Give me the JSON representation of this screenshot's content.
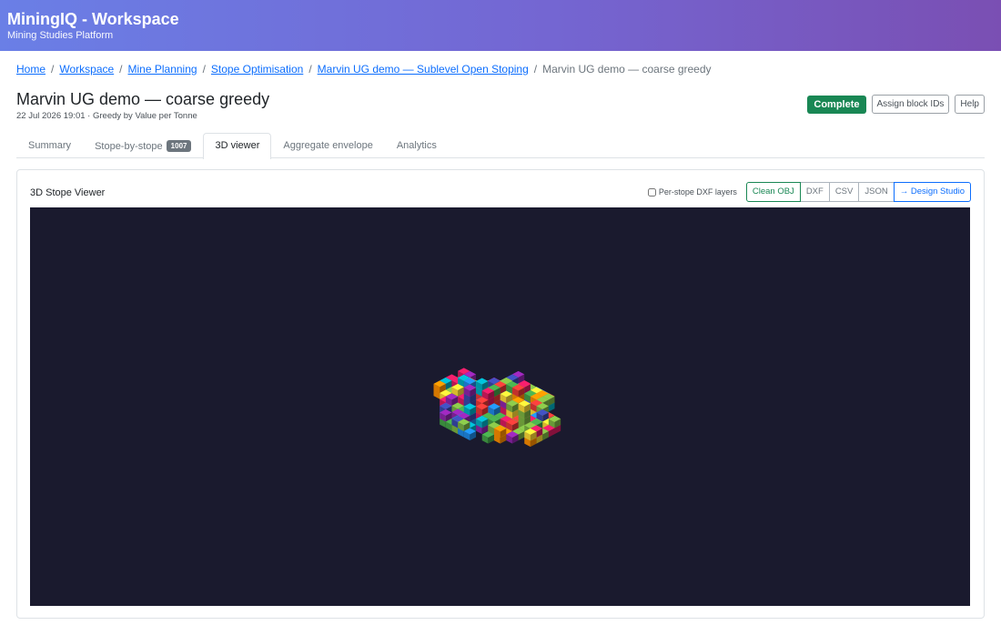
{
  "app": {
    "title": "MiningIQ - Workspace",
    "subtitle": "Mining Studies Platform"
  },
  "breadcrumb": {
    "items": [
      "Home",
      "Workspace",
      "Mine Planning",
      "Stope Optimisation",
      "Marvin UG demo — Sublevel Open Stoping"
    ],
    "current": "Marvin UG demo — coarse greedy",
    "separator": "/"
  },
  "page": {
    "title": "Marvin UG demo — coarse greedy",
    "meta": "22 Jul 2026 19:01 · Greedy by Value per Tonne",
    "status": "Complete",
    "assign_label": "Assign block IDs",
    "help_label": "Help"
  },
  "tabs": [
    {
      "label": "Summary",
      "badge": ""
    },
    {
      "label": "Stope-by-stope",
      "badge": "1007"
    },
    {
      "label": "3D viewer",
      "badge": "",
      "active": true
    },
    {
      "label": "Aggregate envelope",
      "badge": ""
    },
    {
      "label": "Analytics",
      "badge": ""
    }
  ],
  "viewer": {
    "title": "3D Stope Viewer",
    "dxf_layers_label": "Per-stope DXF layers",
    "dxf_layers_checked": false,
    "export_buttons": [
      "Clean OBJ",
      "DXF",
      "CSV",
      "JSON",
      "→ Design Studio"
    ],
    "background": "#1a1a2e",
    "stope_palette": [
      "#e53935",
      "#1e88e5",
      "#43a047",
      "#fdd835",
      "#8e24aa",
      "#fb8c00",
      "#00acc1",
      "#d81b60",
      "#7cb342",
      "#3949ab"
    ]
  },
  "colors": {
    "header_gradient_start": "#6a7fe6",
    "header_gradient_end": "#7a4fb3",
    "status_complete": "#198754",
    "link": "#0d6efd"
  }
}
